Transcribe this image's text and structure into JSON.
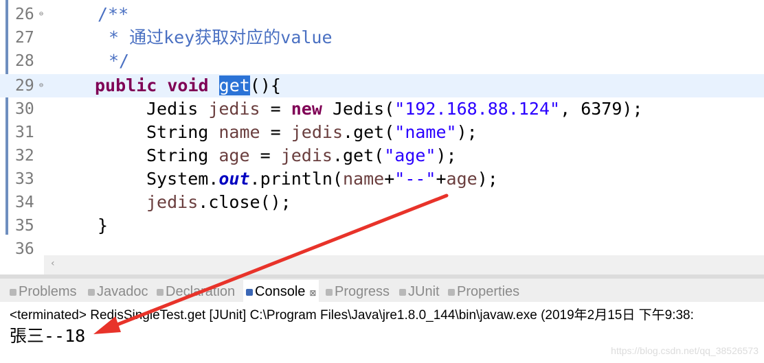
{
  "editor": {
    "lines": [
      {
        "num": "26",
        "fold": "⊖"
      },
      {
        "num": "27",
        "fold": ""
      },
      {
        "num": "28",
        "fold": ""
      },
      {
        "num": "29",
        "fold": "⊖"
      },
      {
        "num": "30",
        "fold": ""
      },
      {
        "num": "31",
        "fold": ""
      },
      {
        "num": "32",
        "fold": ""
      },
      {
        "num": "33",
        "fold": ""
      },
      {
        "num": "34",
        "fold": ""
      },
      {
        "num": "35",
        "fold": ""
      },
      {
        "num": "36",
        "fold": ""
      }
    ],
    "code": {
      "l26": "/**",
      "l27_star": "* ",
      "l27_text": "通过key获取对应的value",
      "l28": "*/",
      "l29_kw": "public void",
      "l29_sel": "get",
      "l29_rest": "(){",
      "l30_type": "Jedis",
      "l30_var": "jedis",
      "l30_eq": " = ",
      "l30_new": "new",
      "l30_ctor": " Jedis(",
      "l30_str": "\"192.168.88.124\"",
      "l30_rest": ", 6379);",
      "l31_type": "String",
      "l31_var": "name",
      "l31_eq": " = ",
      "l31_obj": "jedis",
      "l31_call": ".get(",
      "l31_str": "\"name\"",
      "l31_end": ");",
      "l32_type": "String",
      "l32_var": "age",
      "l32_eq": " = ",
      "l32_obj": "jedis",
      "l32_call": ".get(",
      "l32_str": "\"age\"",
      "l32_end": ");",
      "l33_sys": "System.",
      "l33_out": "out",
      "l33_call": ".println(",
      "l33_name": "name",
      "l33_plus": "+",
      "l33_str": "\"--\"",
      "l33_plus2": "+",
      "l33_age": "age",
      "l33_end": ");",
      "l34_obj": "jedis",
      "l34_call": ".close();",
      "l35": "}"
    },
    "scroll_left_glyph": "‹"
  },
  "tabs": [
    {
      "label": "Problems",
      "active": false
    },
    {
      "label": "Javadoc",
      "active": false
    },
    {
      "label": "Declaration",
      "active": false
    },
    {
      "label": "Console",
      "active": true,
      "close": "⊠"
    },
    {
      "label": "Progress",
      "active": false
    },
    {
      "label": "JUnit",
      "active": false
    },
    {
      "label": "Properties",
      "active": false
    }
  ],
  "console": {
    "terminated_line": "<terminated> RedisSingleTest.get [JUnit] C:\\Program Files\\Java\\jre1.8.0_144\\bin\\javaw.exe (2019年2月15日 下午9:38:",
    "output": "張三--18"
  },
  "watermark": "https://blog.csdn.net/qq_38526573",
  "annotation": {
    "color": "#e8332a",
    "shape": "arrow"
  }
}
